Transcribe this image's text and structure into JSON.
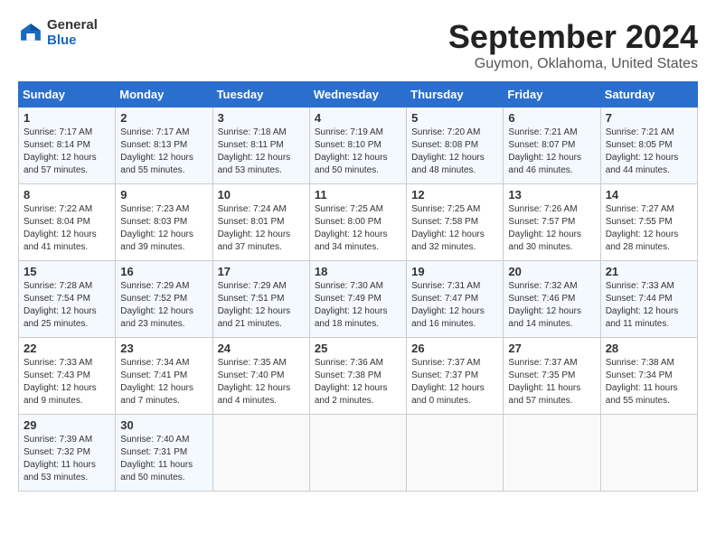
{
  "header": {
    "logo_general": "General",
    "logo_blue": "Blue",
    "title": "September 2024",
    "location": "Guymon, Oklahoma, United States"
  },
  "days_of_week": [
    "Sunday",
    "Monday",
    "Tuesday",
    "Wednesday",
    "Thursday",
    "Friday",
    "Saturday"
  ],
  "weeks": [
    [
      {
        "day": "1",
        "sunrise": "7:17 AM",
        "sunset": "8:14 PM",
        "daylight": "12 hours and 57 minutes."
      },
      {
        "day": "2",
        "sunrise": "7:17 AM",
        "sunset": "8:13 PM",
        "daylight": "12 hours and 55 minutes."
      },
      {
        "day": "3",
        "sunrise": "7:18 AM",
        "sunset": "8:11 PM",
        "daylight": "12 hours and 53 minutes."
      },
      {
        "day": "4",
        "sunrise": "7:19 AM",
        "sunset": "8:10 PM",
        "daylight": "12 hours and 50 minutes."
      },
      {
        "day": "5",
        "sunrise": "7:20 AM",
        "sunset": "8:08 PM",
        "daylight": "12 hours and 48 minutes."
      },
      {
        "day": "6",
        "sunrise": "7:21 AM",
        "sunset": "8:07 PM",
        "daylight": "12 hours and 46 minutes."
      },
      {
        "day": "7",
        "sunrise": "7:21 AM",
        "sunset": "8:05 PM",
        "daylight": "12 hours and 44 minutes."
      }
    ],
    [
      {
        "day": "8",
        "sunrise": "7:22 AM",
        "sunset": "8:04 PM",
        "daylight": "12 hours and 41 minutes."
      },
      {
        "day": "9",
        "sunrise": "7:23 AM",
        "sunset": "8:03 PM",
        "daylight": "12 hours and 39 minutes."
      },
      {
        "day": "10",
        "sunrise": "7:24 AM",
        "sunset": "8:01 PM",
        "daylight": "12 hours and 37 minutes."
      },
      {
        "day": "11",
        "sunrise": "7:25 AM",
        "sunset": "8:00 PM",
        "daylight": "12 hours and 34 minutes."
      },
      {
        "day": "12",
        "sunrise": "7:25 AM",
        "sunset": "7:58 PM",
        "daylight": "12 hours and 32 minutes."
      },
      {
        "day": "13",
        "sunrise": "7:26 AM",
        "sunset": "7:57 PM",
        "daylight": "12 hours and 30 minutes."
      },
      {
        "day": "14",
        "sunrise": "7:27 AM",
        "sunset": "7:55 PM",
        "daylight": "12 hours and 28 minutes."
      }
    ],
    [
      {
        "day": "15",
        "sunrise": "7:28 AM",
        "sunset": "7:54 PM",
        "daylight": "12 hours and 25 minutes."
      },
      {
        "day": "16",
        "sunrise": "7:29 AM",
        "sunset": "7:52 PM",
        "daylight": "12 hours and 23 minutes."
      },
      {
        "day": "17",
        "sunrise": "7:29 AM",
        "sunset": "7:51 PM",
        "daylight": "12 hours and 21 minutes."
      },
      {
        "day": "18",
        "sunrise": "7:30 AM",
        "sunset": "7:49 PM",
        "daylight": "12 hours and 18 minutes."
      },
      {
        "day": "19",
        "sunrise": "7:31 AM",
        "sunset": "7:47 PM",
        "daylight": "12 hours and 16 minutes."
      },
      {
        "day": "20",
        "sunrise": "7:32 AM",
        "sunset": "7:46 PM",
        "daylight": "12 hours and 14 minutes."
      },
      {
        "day": "21",
        "sunrise": "7:33 AM",
        "sunset": "7:44 PM",
        "daylight": "12 hours and 11 minutes."
      }
    ],
    [
      {
        "day": "22",
        "sunrise": "7:33 AM",
        "sunset": "7:43 PM",
        "daylight": "12 hours and 9 minutes."
      },
      {
        "day": "23",
        "sunrise": "7:34 AM",
        "sunset": "7:41 PM",
        "daylight": "12 hours and 7 minutes."
      },
      {
        "day": "24",
        "sunrise": "7:35 AM",
        "sunset": "7:40 PM",
        "daylight": "12 hours and 4 minutes."
      },
      {
        "day": "25",
        "sunrise": "7:36 AM",
        "sunset": "7:38 PM",
        "daylight": "12 hours and 2 minutes."
      },
      {
        "day": "26",
        "sunrise": "7:37 AM",
        "sunset": "7:37 PM",
        "daylight": "12 hours and 0 minutes."
      },
      {
        "day": "27",
        "sunrise": "7:37 AM",
        "sunset": "7:35 PM",
        "daylight": "11 hours and 57 minutes."
      },
      {
        "day": "28",
        "sunrise": "7:38 AM",
        "sunset": "7:34 PM",
        "daylight": "11 hours and 55 minutes."
      }
    ],
    [
      {
        "day": "29",
        "sunrise": "7:39 AM",
        "sunset": "7:32 PM",
        "daylight": "11 hours and 53 minutes."
      },
      {
        "day": "30",
        "sunrise": "7:40 AM",
        "sunset": "7:31 PM",
        "daylight": "11 hours and 50 minutes."
      },
      null,
      null,
      null,
      null,
      null
    ]
  ]
}
